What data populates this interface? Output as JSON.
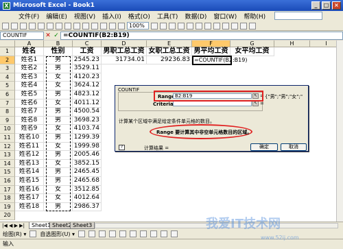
{
  "window": {
    "title": "Microsoft Excel - Book1",
    "btn_min": "_",
    "btn_max": "□",
    "btn_close": "×"
  },
  "menu": {
    "items": [
      "文件(F)",
      "编辑(E)",
      "视图(V)",
      "插入(I)",
      "格式(O)",
      "工具(T)",
      "数据(D)",
      "窗口(W)",
      "帮助(H)"
    ],
    "help_placeholder": ""
  },
  "toolbar": {
    "zoom": "100%"
  },
  "formula_bar": {
    "name_box": "COUNTIF",
    "cancel": "✕",
    "enter": "✓",
    "formula": "=COUNTIF(B2:B19)"
  },
  "sheet": {
    "columns": [
      "A",
      "B",
      "C",
      "D",
      "E",
      "F",
      "G",
      "H",
      "I"
    ],
    "headers": [
      "姓名",
      "性别",
      "工资",
      "男职工总工资",
      "女职工总工资",
      "男平均工资",
      "女平均工资"
    ],
    "rows": [
      [
        "姓名1",
        "男",
        "2545.23"
      ],
      [
        "姓名2",
        "男",
        "3529.11"
      ],
      [
        "姓名3",
        "女",
        "4120.23"
      ],
      [
        "姓名4",
        "女",
        "3624.12"
      ],
      [
        "姓名5",
        "男",
        "4823.12"
      ],
      [
        "姓名6",
        "女",
        "4011.12"
      ],
      [
        "姓名7",
        "男",
        "4500.54"
      ],
      [
        "姓名8",
        "男",
        "3698.23"
      ],
      [
        "姓名9",
        "女",
        "4103.74"
      ],
      [
        "姓名10",
        "男",
        "1299.39"
      ],
      [
        "姓名11",
        "女",
        "1999.98"
      ],
      [
        "姓名12",
        "男",
        "2005.46"
      ],
      [
        "姓名13",
        "女",
        "3852.15"
      ],
      [
        "姓名14",
        "男",
        "2465.45"
      ],
      [
        "姓名15",
        "男",
        "2465.68"
      ],
      [
        "姓名16",
        "女",
        "3512.85"
      ],
      [
        "姓名17",
        "女",
        "4012.64"
      ],
      [
        "姓名18",
        "男",
        "2986.37"
      ]
    ],
    "d2": "31734.01",
    "e2": "29236.83",
    "f2": "=COUNTIF(B2:B19)"
  },
  "dialog": {
    "title": "COUNTIF",
    "range_label": "Range",
    "range_value": "B2:B19",
    "criteria_label": "Criteria",
    "criteria_value": "",
    "collapse": "↖",
    "eq": "=",
    "range_result": "{\"男\";\"男\";\"女\";\"",
    "criteria_result": "",
    "description": "计算某个区域中满足给定条件单元格的数目。",
    "range_help": "Range  要计算其中非空单元格数目的区域。",
    "result_label": "计算结果 =",
    "ok": "确定",
    "cancel": "取消",
    "help": "?"
  },
  "sheet_tabs": {
    "nav": "|◀ ◀ ▶ ▶|",
    "tabs": [
      "Sheet1",
      "Sheet2",
      "Sheet3"
    ]
  },
  "draw_toolbar": {
    "draw": "绘图(R) ▾",
    "autoshapes": "自选图形(U) ▾"
  },
  "status": {
    "text": "输入"
  },
  "watermark": {
    "text": "我爱IT技术网",
    "url": "www.52ij.com"
  }
}
